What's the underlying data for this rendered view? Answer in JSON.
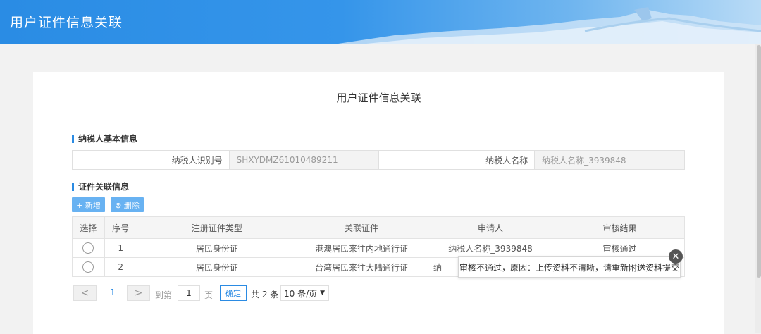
{
  "header": {
    "title": "用户证件信息关联"
  },
  "page_title": "用户证件信息关联",
  "section_basic": {
    "title": "纳税人基本信息"
  },
  "basic": {
    "taxpayer_id_label": "纳税人识别号",
    "taxpayer_id_value": "SHXYDMZ61010489211",
    "taxpayer_name_label": "纳税人名称",
    "taxpayer_name_value": "纳税人名称_3939848"
  },
  "section_cert": {
    "title": "证件关联信息"
  },
  "toolbar": {
    "add_label": "+ 新增",
    "delete_label": "⊗ 删除"
  },
  "table": {
    "headers": [
      "选择",
      "序号",
      "注册证件类型",
      "关联证件",
      "申请人",
      "审核结果"
    ],
    "rows": [
      {
        "index": "1",
        "reg_type": "居民身份证",
        "linked": "港澳居民来往内地通行证",
        "applicant": "纳税人名称_3939848",
        "result": "审核通过"
      },
      {
        "index": "2",
        "reg_type": "居民身份证",
        "linked": "台湾居民来往大陆通行证",
        "applicant": "纳",
        "result": ""
      }
    ]
  },
  "pager": {
    "prev": "<",
    "next": ">",
    "current_page": "1",
    "goto_label": "到第",
    "page_input": "1",
    "page_suffix": "页",
    "confirm": "确定",
    "total": "共 2 条",
    "page_size": "10 条/页"
  },
  "tooltip": {
    "text": "审核不通过，原因：上传资料不清晰，请重新附送资料提交",
    "close": "✕"
  },
  "colors": {
    "accent": "#2b8be3",
    "button": "#68b2f2"
  }
}
